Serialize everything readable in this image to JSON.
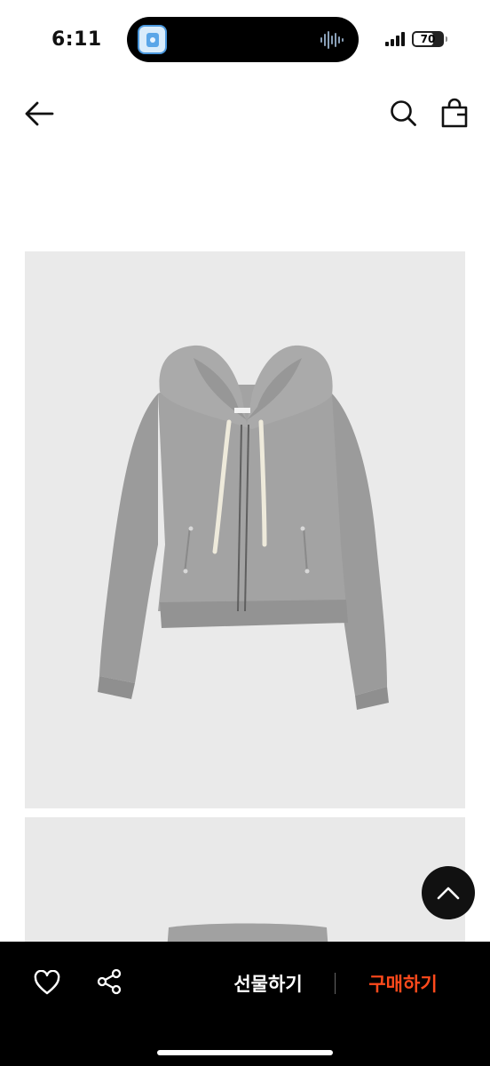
{
  "status_bar": {
    "time": "6:11",
    "battery_percent": 70,
    "battery_label": "70",
    "island_app_icon": "laundry-app-icon",
    "activity_icon": "audio-waveform-icon"
  },
  "nav": {
    "back_icon": "arrow-left-icon",
    "search_icon": "search-icon",
    "cart_icon": "shopping-bag-icon"
  },
  "product": {
    "image_1": "grey-zip-up-hoodie-photo",
    "image_2": "grey-zip-up-hoodie-photo-partial"
  },
  "scroll_top": {
    "icon": "chevron-up-icon"
  },
  "bottom_bar": {
    "wishlist_icon": "heart-icon",
    "share_icon": "share-icon",
    "gift_label": "선물하기",
    "buy_label": "구매하기",
    "buy_color": "#ff4a1c",
    "background": "#000000"
  }
}
